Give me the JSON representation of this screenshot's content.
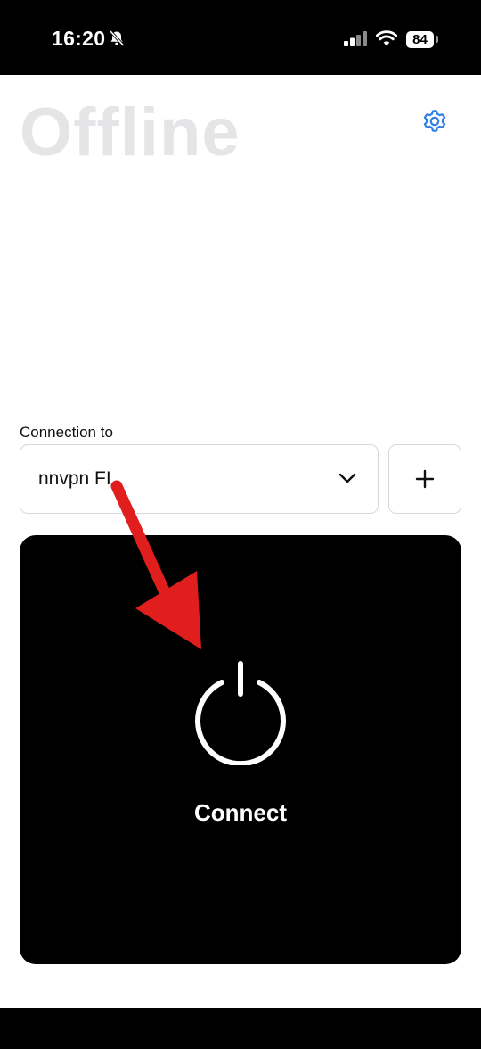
{
  "status_bar": {
    "time": "16:20",
    "battery": "84",
    "icons": [
      "bell-slash-icon",
      "cellular-signal-icon",
      "wifi-icon",
      "battery-icon"
    ]
  },
  "header": {
    "status_title": "Offline",
    "settings_icon": "gear-icon"
  },
  "connection": {
    "label": "Connection to",
    "selected_server": "nnvpn FI",
    "add_icon": "plus-icon"
  },
  "connect_panel": {
    "label": "Connect",
    "icon": "power-icon"
  },
  "annotation": {
    "arrow_color": "#e01e1e"
  },
  "colors": {
    "accent": "#2f7fe6",
    "title_muted": "#e5e5e8",
    "panel": "#000000"
  }
}
